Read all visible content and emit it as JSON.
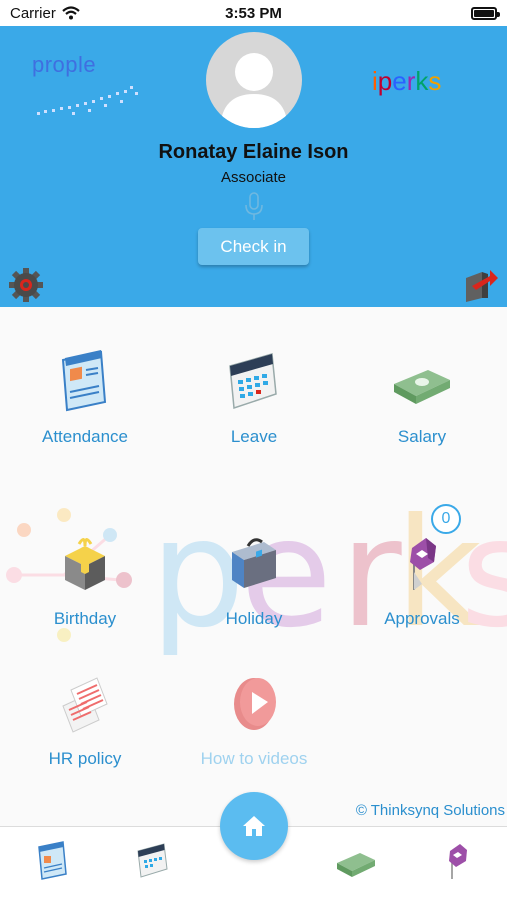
{
  "status_bar": {
    "carrier": "Carrier",
    "time": "3:53 PM"
  },
  "header": {
    "brand_left": "prople",
    "brand_right": [
      "i",
      "p",
      "e",
      "r",
      "k",
      "s"
    ],
    "user_name": "Ronatay Elaine Ison",
    "user_role": "Associate",
    "checkin_label": "Check in",
    "bg_color": "#3aa9e8"
  },
  "menu": {
    "attendance": "Attendance",
    "leave": "Leave",
    "salary": "Salary",
    "birthday": "Birthday",
    "holiday": "Holiday",
    "approvals": "Approvals",
    "approvals_badge": "0",
    "hr_policy": "HR policy",
    "how_to_videos": "How to videos"
  },
  "watermark": "perks",
  "footer": {
    "copyright": "© Thinksynq Solutions"
  },
  "icons": [
    "wifi-icon",
    "battery-icon",
    "avatar-icon",
    "mic-icon",
    "gear-icon",
    "logout-icon",
    "attendance-icon",
    "leave-calendar-icon",
    "salary-money-icon",
    "birthday-gift-icon",
    "holiday-briefcase-icon",
    "approvals-icon",
    "hr-policy-icon",
    "video-play-icon",
    "home-icon"
  ]
}
